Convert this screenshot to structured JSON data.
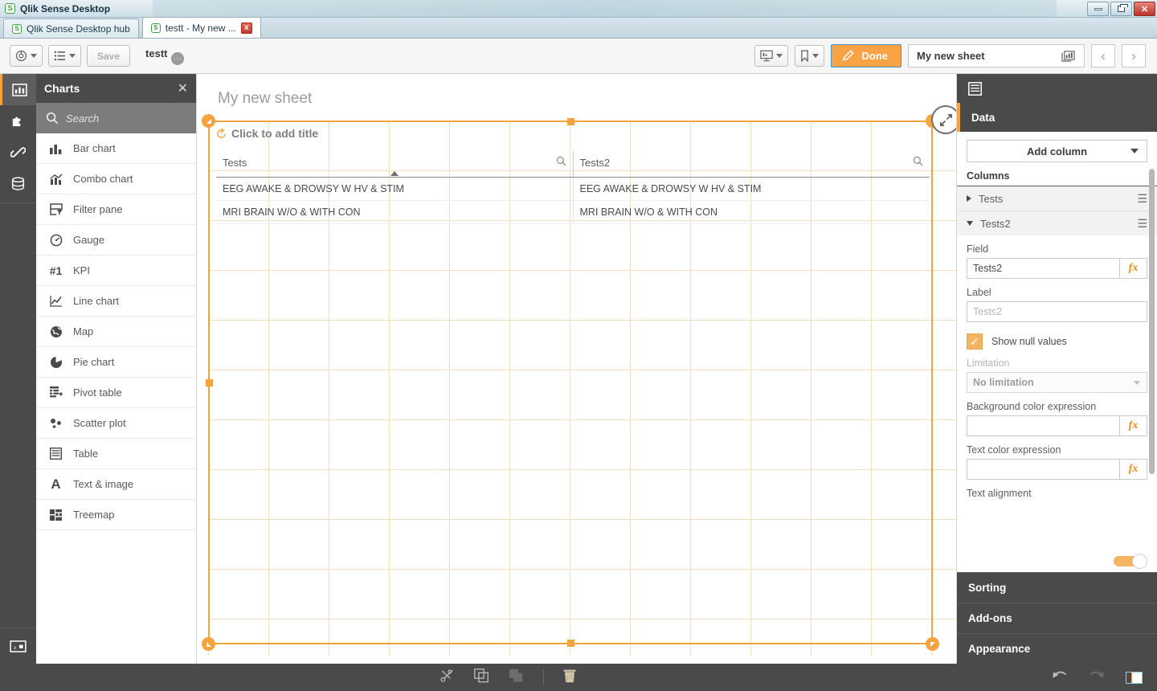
{
  "window": {
    "title": "Qlik Sense Desktop",
    "controls": {
      "minimize": "minimize",
      "restore": "restore",
      "close": "close"
    }
  },
  "tabs": [
    {
      "label": "Qlik Sense Desktop hub",
      "active": false,
      "closable": false
    },
    {
      "label": "testt - My new ...",
      "active": true,
      "closable": true,
      "close_label": "x"
    }
  ],
  "toolbar": {
    "nav_button": "navigation-menu",
    "sheets_button": "sheet-list",
    "save_label": "Save",
    "app_name": "testt",
    "app_menu": "...",
    "storytelling_button": "storytelling",
    "bookmarks_button": "bookmarks",
    "done_label": "Done",
    "sheet_name": "My new sheet",
    "chart_selector": "chart-type",
    "prev_label": "‹",
    "next_label": "›"
  },
  "rail": {
    "items": [
      {
        "name": "charts",
        "active": true
      },
      {
        "name": "custom-objects",
        "active": false
      },
      {
        "name": "master-items",
        "active": false
      },
      {
        "name": "fields",
        "active": false
      }
    ],
    "bottom_item": "variables"
  },
  "charts_panel": {
    "title": "Charts",
    "close_label": "✕",
    "search_placeholder": "Search",
    "items": [
      {
        "label": "Bar chart",
        "icon": "bar-chart-icon"
      },
      {
        "label": "Combo chart",
        "icon": "combo-chart-icon"
      },
      {
        "label": "Filter pane",
        "icon": "filter-pane-icon"
      },
      {
        "label": "Gauge",
        "icon": "gauge-icon"
      },
      {
        "label": "KPI",
        "icon": "kpi-icon"
      },
      {
        "label": "Line chart",
        "icon": "line-chart-icon"
      },
      {
        "label": "Map",
        "icon": "map-icon"
      },
      {
        "label": "Pie chart",
        "icon": "pie-chart-icon"
      },
      {
        "label": "Pivot table",
        "icon": "pivot-table-icon"
      },
      {
        "label": "Scatter plot",
        "icon": "scatter-plot-icon"
      },
      {
        "label": "Table",
        "icon": "table-icon"
      },
      {
        "label": "Text & image",
        "icon": "text-image-icon"
      },
      {
        "label": "Treemap",
        "icon": "treemap-icon"
      }
    ]
  },
  "canvas": {
    "sheet_title": "My new sheet",
    "object_title_placeholder": "Click to add title",
    "expand_label": "expand",
    "table": {
      "columns": [
        {
          "header": "Tests",
          "sorted": true,
          "sort_direction": "ascending"
        },
        {
          "header": "Tests2",
          "sorted": false
        }
      ],
      "rows": [
        [
          "EEG AWAKE & DROWSY W HV & STIM",
          "EEG AWAKE & DROWSY W HV & STIM"
        ],
        [
          "MRI BRAIN W/O & WITH CON",
          "MRI BRAIN W/O & WITH CON"
        ]
      ]
    }
  },
  "properties": {
    "object_icon": "table-icon",
    "data_section": "Data",
    "add_column_label": "Add column",
    "columns_label": "Columns",
    "columns": [
      {
        "name": "Tests",
        "expanded": false
      },
      {
        "name": "Tests2",
        "expanded": true
      }
    ],
    "field_label": "Field",
    "field_value": "Tests2",
    "label_label": "Label",
    "label_placeholder": "Tests2",
    "show_null_label": "Show null values",
    "show_null_checked": true,
    "limitation_label": "Limitation",
    "limitation_value": "No limitation",
    "bg_color_label": "Background color expression",
    "bg_color_value": "",
    "text_color_label": "Text color expression",
    "text_color_value": "",
    "text_alignment_label": "Text alignment",
    "fx_label": "fx",
    "sections": [
      "Sorting",
      "Add-ons",
      "Appearance"
    ]
  },
  "bottom_bar": {
    "cut_label": "cut",
    "copy_label": "copy",
    "paste_label": "paste",
    "delete_label": "delete",
    "undo_label": "undo",
    "redo_label": "redo",
    "panel_toggle_label": "toggle-panel"
  },
  "colors": {
    "accent_orange": "#f5a33c",
    "panel_dark": "#4a4a4a",
    "grid_line": "#f3d5ad",
    "fx_orange": "#f08b1d"
  }
}
